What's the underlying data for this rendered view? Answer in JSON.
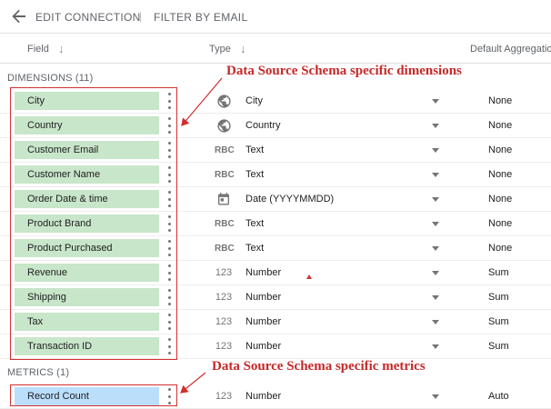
{
  "topbar": {
    "edit_connection": "EDIT CONNECTION",
    "separator": "|",
    "filter_by_email": "FILTER BY EMAIL"
  },
  "columns": {
    "field": "Field",
    "type": "Type",
    "default_aggregation": "Default Aggregation"
  },
  "dimensions": {
    "label": "DIMENSIONS (11)",
    "items": [
      {
        "name": "City",
        "type_icon": "globe-icon",
        "type": "City",
        "aggregation": "None"
      },
      {
        "name": "Country",
        "type_icon": "globe-icon",
        "type": "Country",
        "aggregation": "None"
      },
      {
        "name": "Customer Email",
        "type_icon": "abc-icon",
        "type": "Text",
        "aggregation": "None"
      },
      {
        "name": "Customer Name",
        "type_icon": "abc-icon",
        "type": "Text",
        "aggregation": "None"
      },
      {
        "name": "Order Date & time",
        "type_icon": "calendar-icon",
        "type": "Date (YYYYMMDD)",
        "aggregation": "None"
      },
      {
        "name": "Product Brand",
        "type_icon": "abc-icon",
        "type": "Text",
        "aggregation": "None"
      },
      {
        "name": "Product Purchased",
        "type_icon": "abc-icon",
        "type": "Text",
        "aggregation": "None"
      },
      {
        "name": "Revenue",
        "type_icon": "number-icon",
        "type": "Number",
        "aggregation": "Sum"
      },
      {
        "name": "Shipping",
        "type_icon": "number-icon",
        "type": "Number",
        "aggregation": "Sum"
      },
      {
        "name": "Tax",
        "type_icon": "number-icon",
        "type": "Number",
        "aggregation": "Sum"
      },
      {
        "name": "Transaction ID",
        "type_icon": "number-icon",
        "type": "Number",
        "aggregation": "Sum"
      }
    ]
  },
  "metrics": {
    "label": "METRICS (1)",
    "items": [
      {
        "name": "Record Count",
        "type_icon": "number-icon",
        "type": "Number",
        "aggregation": "Auto"
      }
    ]
  },
  "icon_text": {
    "abc": "RBC",
    "number": "123"
  },
  "annotations": {
    "dimensions_note": "Data Source Schema specific dimensions",
    "metrics_note": "Data Source Schema specific metrics"
  },
  "colors": {
    "dimension_chip": "#c8e6c9",
    "metric_chip": "#bbdefb",
    "annotation": "#c62828"
  }
}
